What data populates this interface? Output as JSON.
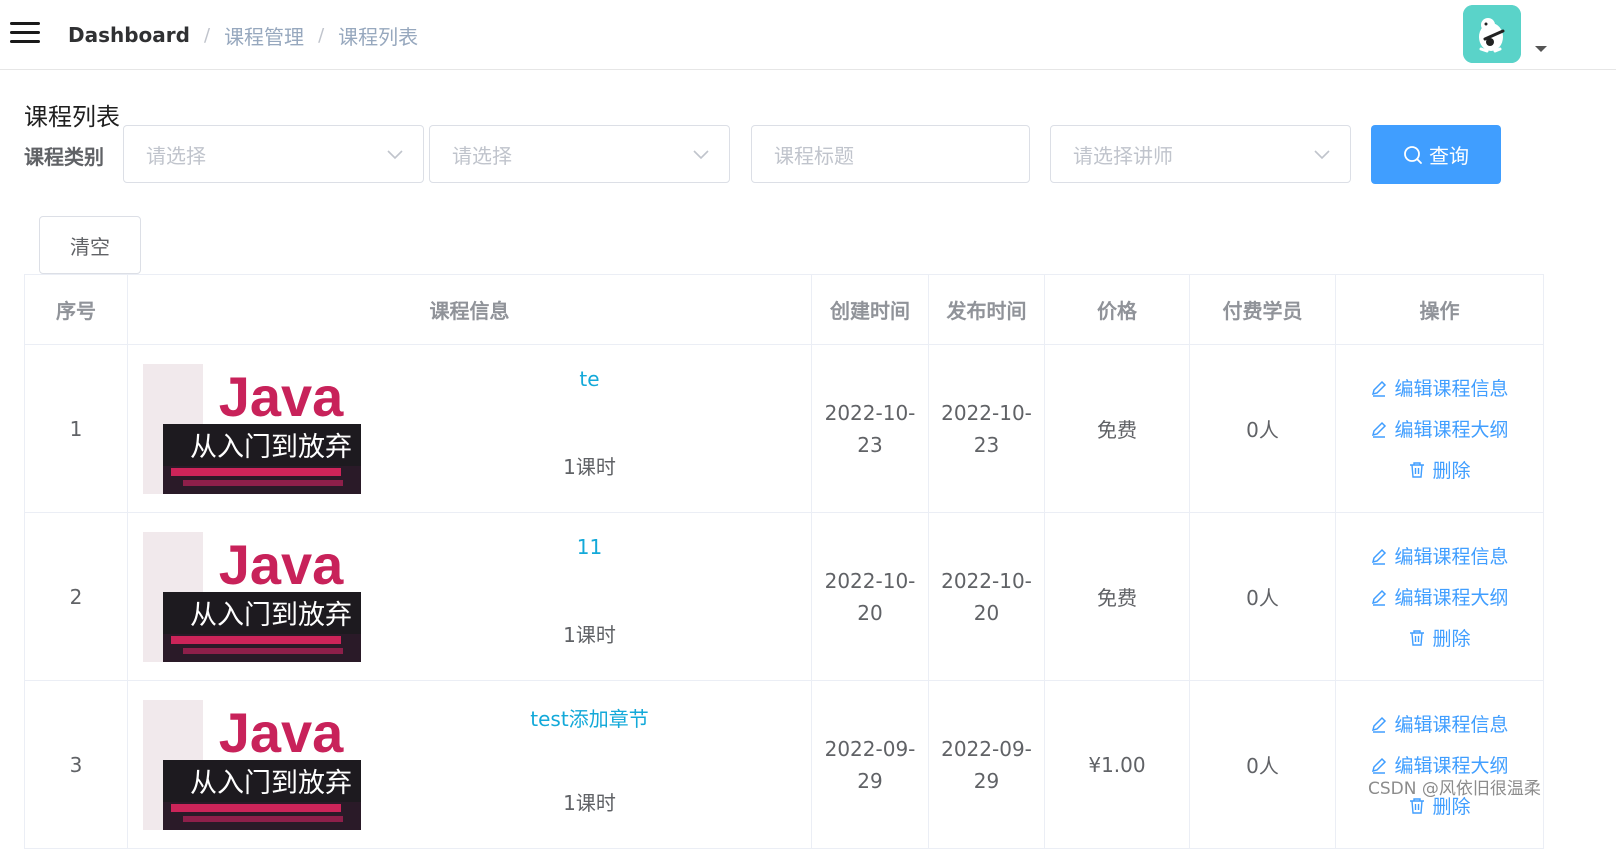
{
  "breadcrumb": {
    "home": "Dashboard",
    "level2": "课程管理",
    "level3": "课程列表"
  },
  "page": {
    "title": "课程列表",
    "filter_label": "课程类别"
  },
  "filters": {
    "category1_placeholder": "请选择",
    "category2_placeholder": "请选择",
    "title_placeholder": "课程标题",
    "teacher_placeholder": "请选择讲师",
    "query_button": "查询",
    "clear_button": "清空"
  },
  "table": {
    "headers": [
      "序号",
      "课程信息",
      "创建时间",
      "发布时间",
      "价格",
      "付费学员",
      "操作"
    ],
    "cover": {
      "word": "Java",
      "subtitle": "从入门到放弃"
    },
    "rows": [
      {
        "index": "1",
        "title": "te",
        "lessons": "1课时",
        "created": "2022-10-23",
        "published": "2022-10-23",
        "price": "免费",
        "students": "0人"
      },
      {
        "index": "2",
        "title": "11",
        "lessons": "1课时",
        "created": "2022-10-20",
        "published": "2022-10-20",
        "price": "免费",
        "students": "0人"
      },
      {
        "index": "3",
        "title": "test添加章节",
        "lessons": "1课时",
        "created": "2022-09-29",
        "published": "2022-09-29",
        "price": "¥1.00",
        "students": "0人"
      }
    ],
    "ops": {
      "edit_info": "编辑课程信息",
      "edit_outline": "编辑课程大纲",
      "delete": "删除"
    }
  },
  "colors": {
    "primary": "#409eff",
    "link": "#13a9d9",
    "avatar_bg": "#5ad3c9"
  },
  "watermark": "CSDN @风依旧很温柔"
}
